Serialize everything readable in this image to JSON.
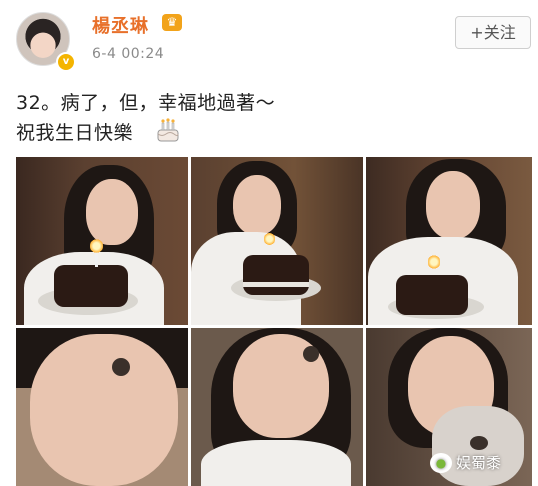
{
  "user": {
    "name": "楊丞琳",
    "timestamp": "6-4 00:24"
  },
  "follow_button": {
    "label": "+关注"
  },
  "post": {
    "line1": "32。病了，但，幸福地過著～",
    "line2": "祝我生日快樂"
  },
  "watermark": {
    "text": "娱蜀黍"
  },
  "colors": {
    "username": "#e8702a",
    "vip_badge": "#f2a31a",
    "verified": "#f4b400"
  }
}
